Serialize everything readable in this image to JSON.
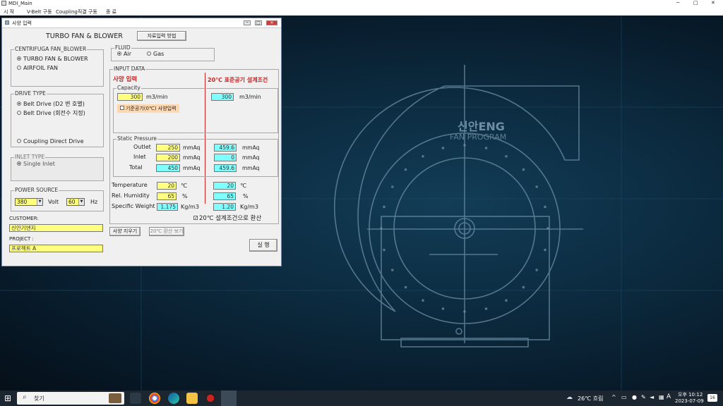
{
  "app": {
    "title": "MDI_Main"
  },
  "menu": {
    "items": [
      "시 작",
      "V-Belt 구동",
      "Coupling직결 구동",
      "종 료"
    ]
  },
  "window_controls": {
    "min": "─",
    "max": "□",
    "close": "✕"
  },
  "background": {
    "brand": "신안ENG",
    "subtitle": "FAN PROGRAM"
  },
  "dialog": {
    "title": "사양 입력",
    "heading": "TURBO FAN & BLOWER",
    "top_button": "자료입력 방법",
    "centrifugal": {
      "legend": "CENTRIFUGA FAN_BLOWER",
      "options": [
        "TURBO FAN & BLOWER",
        "AIRFOIL FAN"
      ],
      "selected": 0
    },
    "drive": {
      "legend": "DRIVE TYPE",
      "options": [
        "Belt Drive (D2 변 호별)",
        "Belt Drive (회전수 지정)",
        "Coupling Direct Drive"
      ],
      "selected": 0
    },
    "inlet": {
      "legend": "INLET TYPE",
      "option": "Single Inlet"
    },
    "power": {
      "legend": "POWER SOURCE",
      "volt": "380",
      "volt_label": "Volt",
      "hz": "60",
      "hz_label": "Hz"
    },
    "customer": {
      "label": "CUSTOMER:",
      "value": "신안기엔지"
    },
    "project": {
      "label": "PROJECT   :",
      "value": "프로젝트 A"
    },
    "fluid": {
      "legend": "FLUID",
      "options": [
        "Air",
        "Gas"
      ],
      "selected": 0
    },
    "input_data": {
      "legend": "INPUT DATA",
      "left_title": "사양 입력",
      "right_title": "20℃ 표준공기 설계조건",
      "capacity": {
        "legend": "Capacity",
        "value": "300",
        "unit": "m3/min",
        "std_value": "300",
        "std_unit": "m3/min",
        "checkbox": "기준공기(0℃) 사양입력"
      },
      "static_pressure": {
        "legend": "Static Pressure",
        "rows": [
          {
            "label": "Outlet",
            "value": "250",
            "unit": "mmAq",
            "std": "459.6",
            "std_unit": "mmAq"
          },
          {
            "label": "Inlet",
            "value": "200",
            "unit": "mmAq",
            "std": "0",
            "std_unit": "mmAq"
          },
          {
            "label": "Total",
            "value": "450",
            "unit": "mmAq",
            "std": "459.6",
            "std_unit": "mmAq"
          }
        ]
      },
      "rows": [
        {
          "label": "Temperature",
          "value": "20",
          "unit": "℃",
          "std": "20",
          "std_unit": "℃"
        },
        {
          "label": "Rel. Humidity",
          "value": "65",
          "unit": "%",
          "std": "65",
          "std_unit": "%"
        },
        {
          "label": "Specific Weight",
          "value": "1.175",
          "unit": "Kg/m3",
          "std": "1.20",
          "std_unit": "Kg/m3"
        }
      ],
      "convert_checkbox": "20℃ 설계조건으로 환산"
    },
    "buttons": {
      "clear": "사양 지우기",
      "convert_view": "20℃ 환산 보기",
      "run": "실 행"
    }
  },
  "taskbar": {
    "search": "찾기",
    "weather": "26℃ 흐림",
    "time": "오후 10:12",
    "date": "2023-07-09",
    "lang": "A",
    "notify": "16"
  }
}
